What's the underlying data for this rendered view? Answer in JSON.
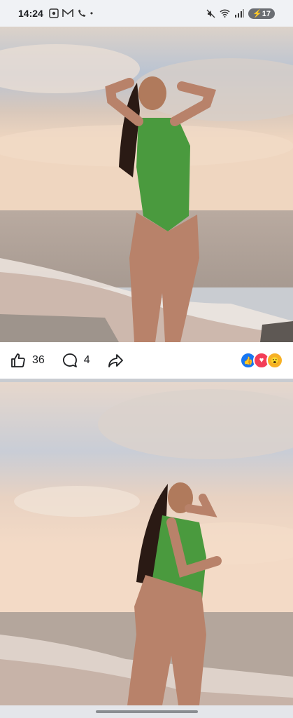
{
  "status_bar": {
    "time": "14:24",
    "left_icons": [
      "screenshot-icon",
      "gmail-icon",
      "call-icon",
      "dot"
    ],
    "right_icons": [
      "mute-icon",
      "wifi-icon",
      "signal-icon"
    ],
    "battery": "17"
  },
  "post": {
    "like_count": "36",
    "comment_count": "4",
    "reactions": [
      "like",
      "love",
      "wow"
    ]
  },
  "colors": {
    "like": "#1877f2",
    "love": "#f33e58",
    "wow": "#f7b125",
    "background": "#c9ccd1"
  }
}
